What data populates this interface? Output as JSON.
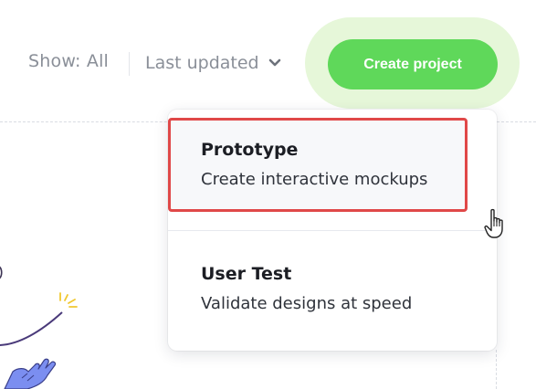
{
  "toolbar": {
    "show_filter_label": "Show: All",
    "sort_label": "Last updated",
    "sort_icon": "chevron-down-icon",
    "create_button_label": "Create project"
  },
  "menu": {
    "items": [
      {
        "title": "Prototype",
        "description": "Create interactive mockups",
        "highlighted": true
      },
      {
        "title": "User Test",
        "description": "Validate designs at speed",
        "highlighted": false
      }
    ]
  },
  "colors": {
    "primary_green": "#5fd85a",
    "halo_green": "#e6f7d9",
    "highlight_red": "#e04848",
    "muted_text": "#8a8f98",
    "title_text": "#1c1e24"
  },
  "cursor": {
    "type": "hand-pointer-icon"
  }
}
